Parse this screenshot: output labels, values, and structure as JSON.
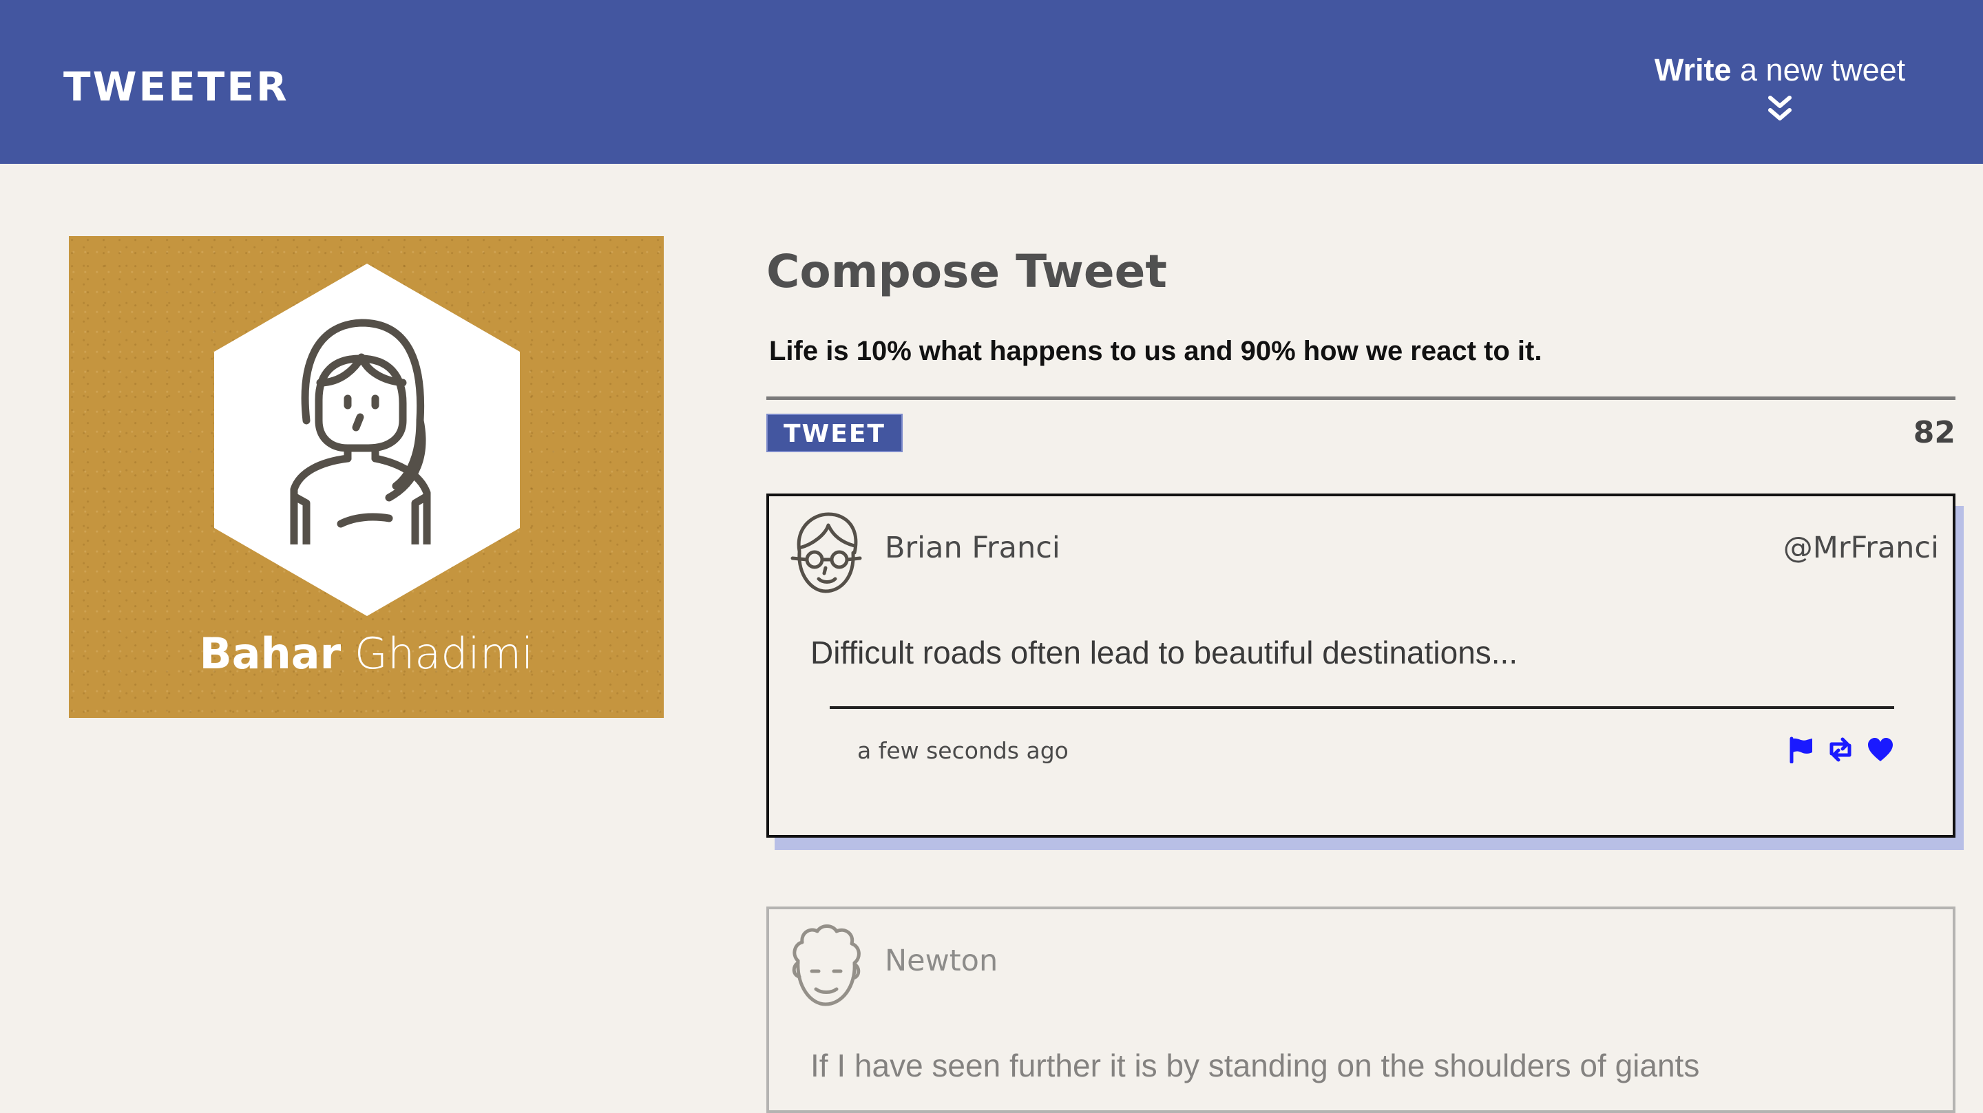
{
  "header": {
    "brand": "TWEETER",
    "compose_cta_bold": "Write",
    "compose_cta_rest": " a new tweet",
    "chevron_icon": "double-chevron-down-icon",
    "background_color": "#4356a0"
  },
  "profile": {
    "first_name": "Bahar",
    "last_name": "Ghadimi",
    "card_color": "#c5953f",
    "avatar_icon": "woman-avatar-icon"
  },
  "compose": {
    "title": "Compose Tweet",
    "text": "Life is 10% what happens to us and 90% how we react to it.",
    "button_label": "TWEET",
    "counter": "82"
  },
  "tweets": [
    {
      "name": "Brian Franci",
      "handle": "@MrFranci",
      "body": "Difficult roads often lead to beautiful destinations...",
      "time": "a few seconds ago",
      "avatar_icon": "man-glasses-avatar-icon",
      "actions": [
        "flag-icon",
        "retweet-icon",
        "heart-icon"
      ],
      "action_color": "#1a1aff"
    },
    {
      "name": "Newton",
      "handle": "",
      "body": "If I have seen further it is by standing on the shoulders of giants",
      "avatar_icon": "curly-hair-avatar-icon"
    }
  ]
}
